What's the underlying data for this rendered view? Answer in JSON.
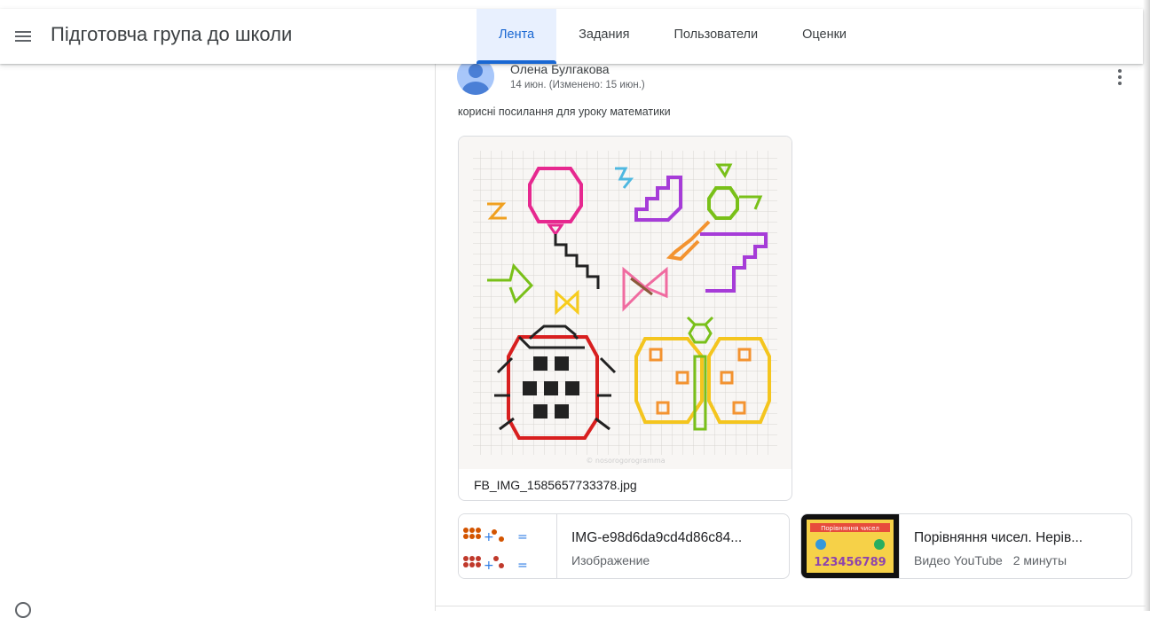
{
  "header": {
    "class_title": "Підготовча група до школи",
    "tabs": [
      {
        "label": "Лента",
        "active": true
      },
      {
        "label": "Задания",
        "active": false
      },
      {
        "label": "Пользователи",
        "active": false
      },
      {
        "label": "Оценки",
        "active": false
      }
    ],
    "accent_color": "#1967d2"
  },
  "post": {
    "author": "Олена Булгакова",
    "date": "14 июн. (Изменено: 15 июн.)",
    "text": "корисні посилання для уроку математики",
    "image_attachment": {
      "filename": "FB_IMG_1585657733378.jpg",
      "watermark": "© nosorogorogramma"
    },
    "attachments": [
      {
        "title": "IMG-e98d6da9cd4d86c84...",
        "type": "Изображение",
        "thumb_icon": "counting-dots-thumbnail-icon"
      },
      {
        "title": "Порівняння чисел. Нерів...",
        "type": "Видео YouTube",
        "duration": "2 минуты",
        "thumb_icon": "video-thumbnail-icon",
        "thumb_caption": "Порівняння чисел",
        "thumb_digits": "123456789"
      }
    ]
  }
}
